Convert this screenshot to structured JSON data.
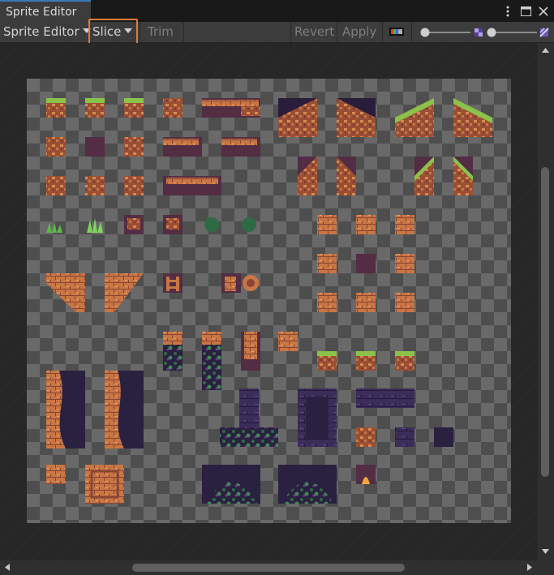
{
  "window": {
    "tab_title": "Sprite Editor",
    "menu_icon": "kebab-menu-icon",
    "maximize_icon": "maximize-icon",
    "close_icon": "close-icon"
  },
  "toolbar": {
    "mode_label": "Sprite Editor",
    "slice_label": "Slice",
    "trim_label": "Trim",
    "revert_label": "Revert",
    "apply_label": "Apply",
    "color_channel_icon": "rgb-channel-icon",
    "zoom_icon": "zoom-slider-icon",
    "mip_icon": "mip-level-icon",
    "alpha_icon": "alpha-checker-icon"
  },
  "colors": {
    "highlight": "#e07a39",
    "grass": "#8bc34a",
    "dirt": "#b8693a",
    "dark_earth": "#522d44",
    "stone_purple": "#3b2d5a",
    "vine": "#2e6b45"
  }
}
